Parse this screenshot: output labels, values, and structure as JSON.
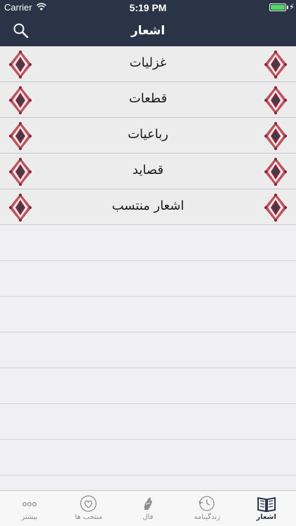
{
  "status_bar": {
    "carrier": "Carrier",
    "time": "5:19 PM",
    "battery_color": "#4cd964"
  },
  "header": {
    "title": "اشعار",
    "left_icon": "search-icon",
    "background": "#2a3446"
  },
  "list": {
    "items": [
      {
        "label": "غزلیات"
      },
      {
        "label": "قطعات"
      },
      {
        "label": "رباعیات"
      },
      {
        "label": "قصاید"
      },
      {
        "label": "اشعار منتسب"
      }
    ],
    "ornament_colors": [
      "#b03a48",
      "#8a2333",
      "#3a3f4f"
    ]
  },
  "tabbar": {
    "tabs": [
      {
        "label": "بیشتر",
        "icon": "more-dots-icon"
      },
      {
        "label": "منتخب ها",
        "icon": "heart-icon"
      },
      {
        "label": "فال",
        "icon": "fal-hand-icon"
      },
      {
        "label": "زندگینامه",
        "icon": "history-clock-icon"
      },
      {
        "label": "اشعار",
        "icon": "book-icon",
        "active": true
      }
    ]
  }
}
